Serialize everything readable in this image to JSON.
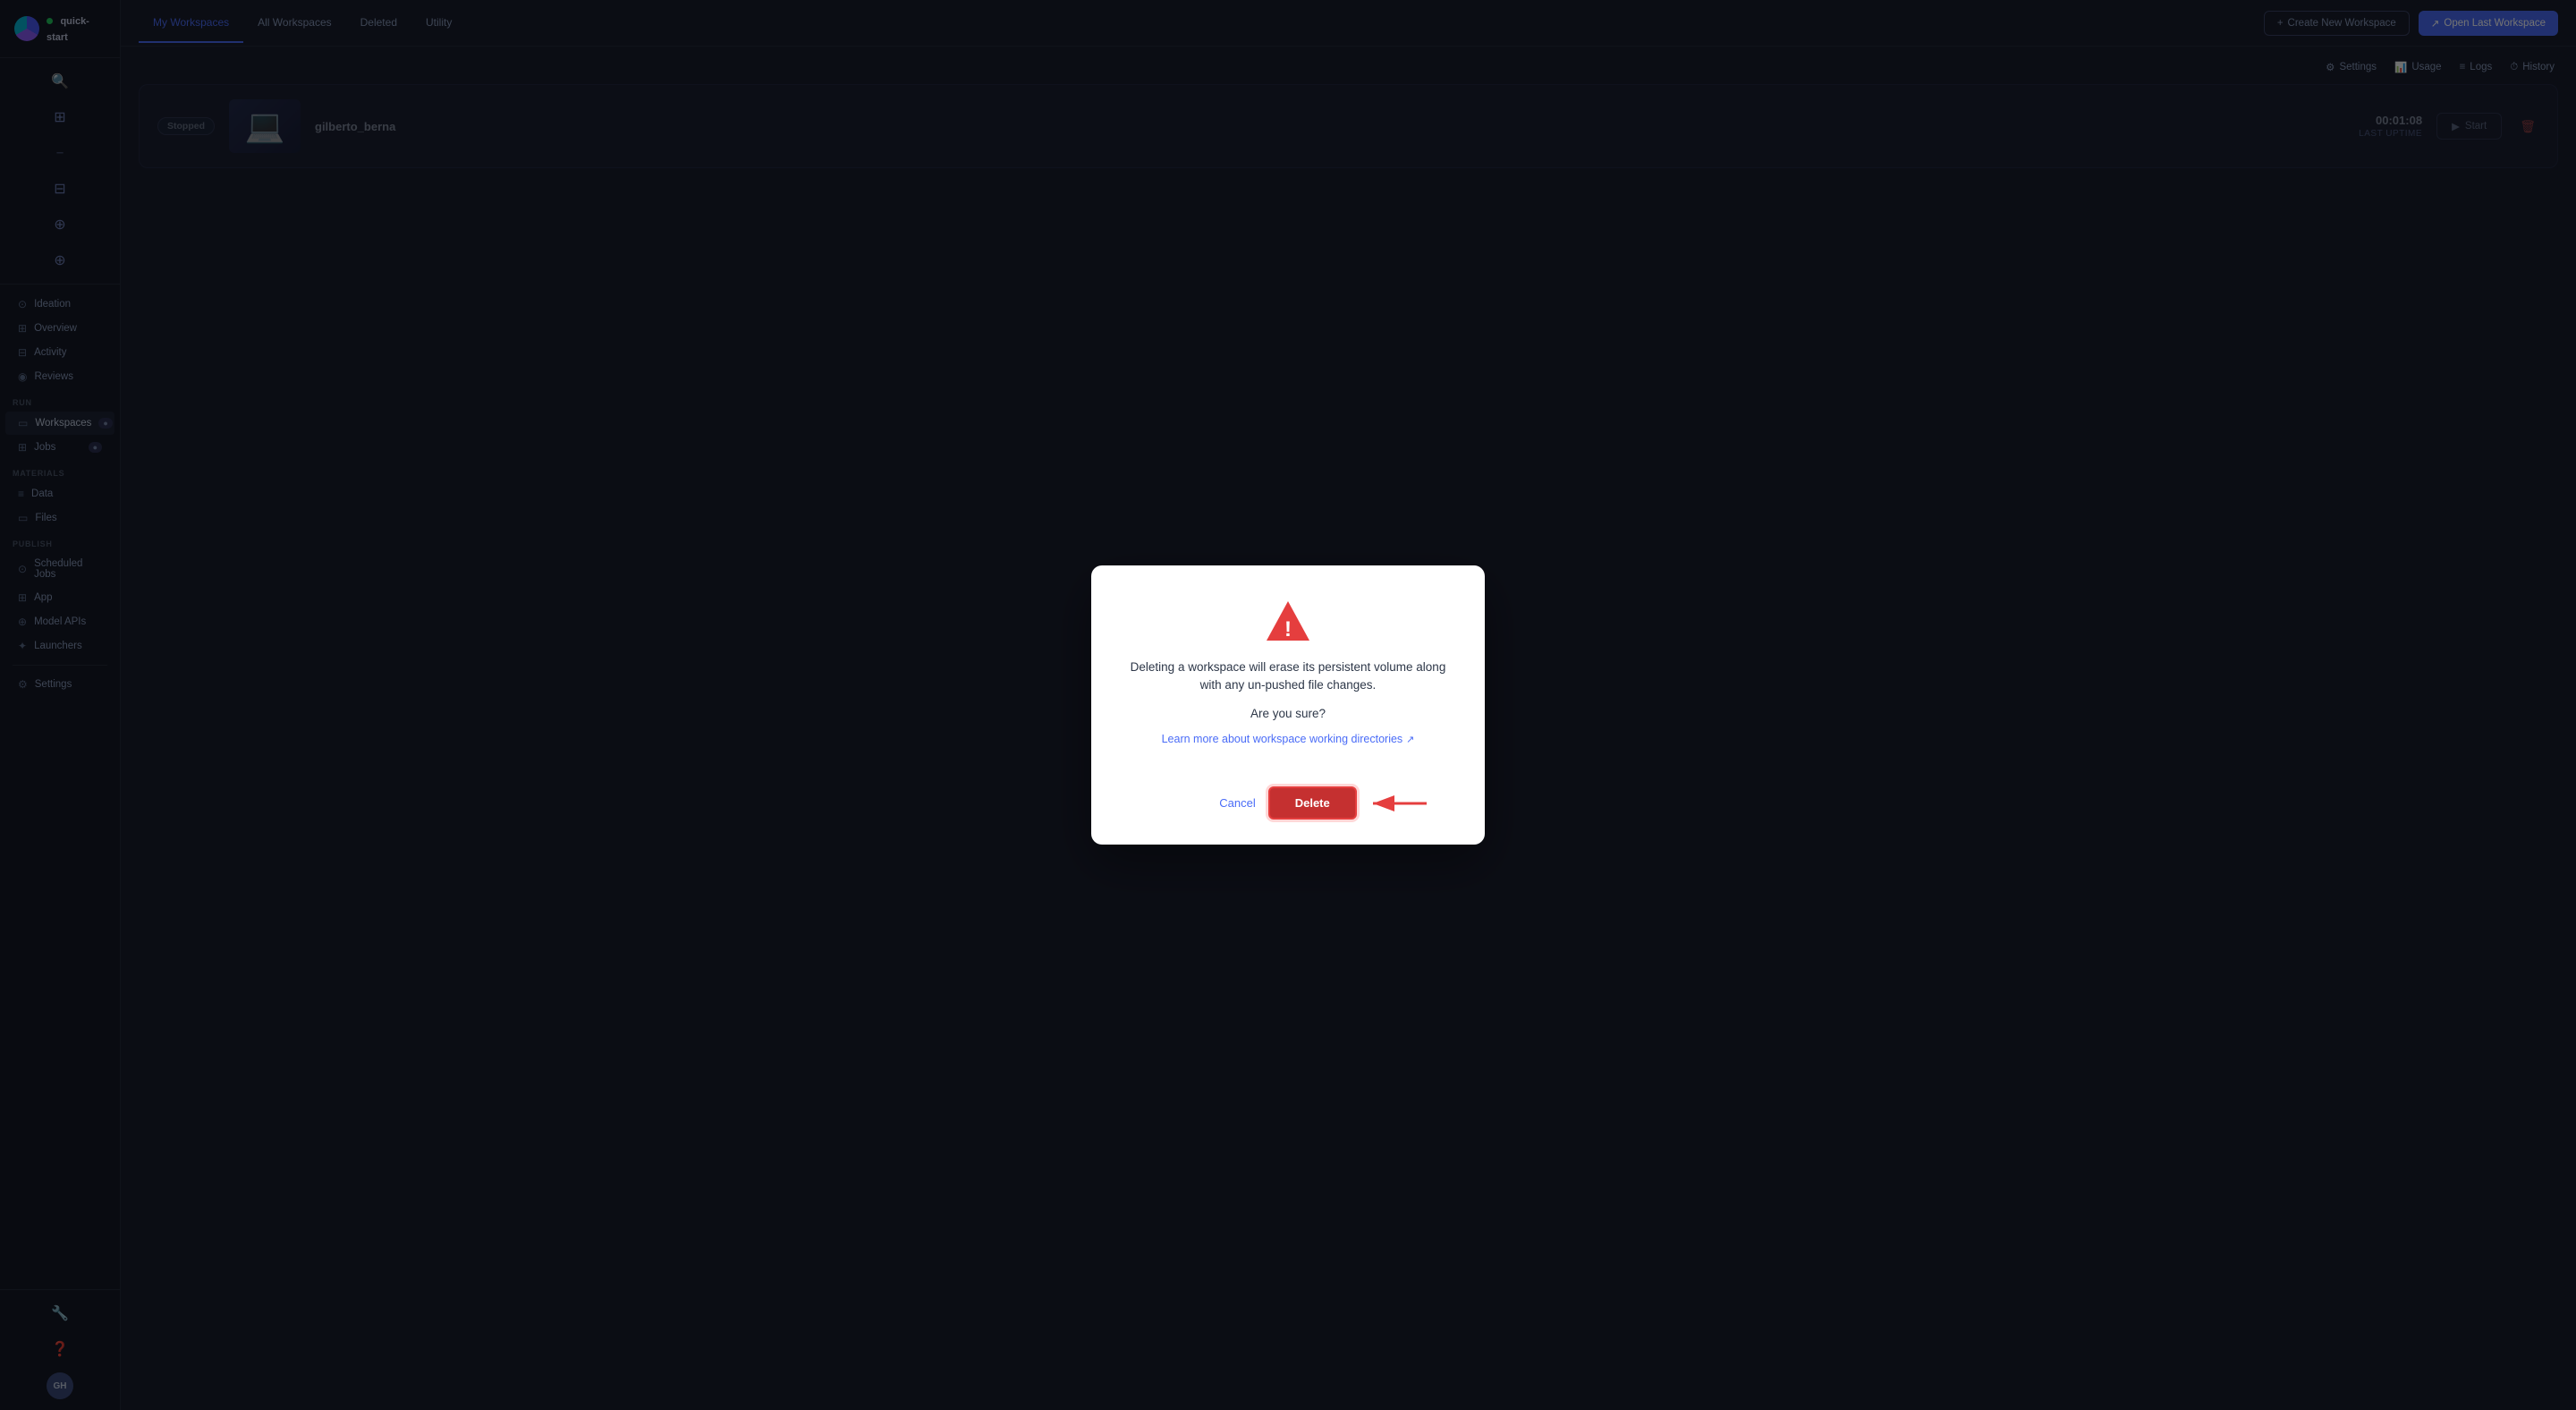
{
  "sidebar": {
    "logo": "●",
    "app_name": "quick-start",
    "status_dot": "●",
    "nav_items": [
      {
        "id": "ideation",
        "label": "Ideation",
        "icon": "⊙",
        "section": null
      },
      {
        "id": "overview",
        "label": "Overview",
        "icon": "⊞",
        "section": null
      },
      {
        "id": "activity",
        "label": "Activity",
        "icon": "⊟",
        "section": null
      },
      {
        "id": "reviews",
        "label": "Reviews",
        "icon": "◉",
        "section": null
      }
    ],
    "run_section": "RUN",
    "run_items": [
      {
        "id": "workspaces",
        "label": "Workspaces",
        "icon": "▭",
        "badge": "●",
        "active": true
      },
      {
        "id": "jobs",
        "label": "Jobs",
        "icon": "⊞",
        "badge": "●"
      }
    ],
    "materials_section": "MATERIALS",
    "materials_items": [
      {
        "id": "data",
        "label": "Data",
        "icon": "≡"
      },
      {
        "id": "files",
        "label": "Files",
        "icon": "▭"
      }
    ],
    "publish_section": "PUBLISH",
    "publish_items": [
      {
        "id": "scheduled-jobs",
        "label": "Scheduled Jobs",
        "icon": "⊙"
      },
      {
        "id": "app",
        "label": "App",
        "icon": "⊞"
      },
      {
        "id": "model-apis",
        "label": "Model APIs",
        "icon": "⊕"
      },
      {
        "id": "launchers",
        "label": "Launchers",
        "icon": "✦"
      }
    ],
    "settings_label": "Settings",
    "settings_icon": "⚙",
    "avatar_label": "GH",
    "search_icon": "🔍",
    "grid_icon": "⊞",
    "divider_icon": "─",
    "stack_icon": "⊟",
    "git_icon": "⊕",
    "tag_icon": "⊕"
  },
  "topbar": {
    "tabs": [
      {
        "id": "my-workspaces",
        "label": "My Workspaces",
        "active": true
      },
      {
        "id": "all-workspaces",
        "label": "All Workspaces",
        "active": false
      },
      {
        "id": "deleted",
        "label": "Deleted",
        "active": false
      },
      {
        "id": "utility",
        "label": "Utility",
        "active": false
      }
    ],
    "create_btn": "Create New Workspace",
    "open_last_btn": "Open Last Workspace"
  },
  "workspace_toolbar": {
    "settings_label": "Settings",
    "usage_label": "Usage",
    "logs_label": "Logs",
    "history_label": "History",
    "settings_icon": "⚙",
    "usage_icon": "📊",
    "logs_icon": "≡",
    "history_icon": "⏱"
  },
  "workspace_card": {
    "status": "Stopped",
    "name": "gilberto_berna",
    "last_uptime_label": "LAST UPTIME",
    "last_uptime_value": "00:01:08",
    "start_btn": "Start",
    "delete_icon": "🗑"
  },
  "modal": {
    "warning_description": "Deleting a workspace will erase its persistent volume along with any un-pushed file changes.",
    "question": "Are you sure?",
    "learn_more_text": "Learn more about workspace working directories",
    "learn_more_icon": "↗",
    "cancel_label": "Cancel",
    "delete_label": "Delete"
  }
}
